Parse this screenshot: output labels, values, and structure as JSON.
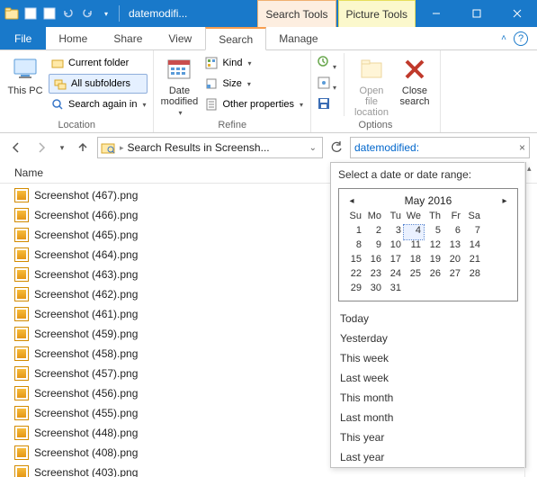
{
  "titlebar": {
    "app_title": "datemodifi...",
    "search_tools_label": "Search Tools",
    "picture_tools_label": "Picture Tools"
  },
  "tabs": {
    "file": "File",
    "home": "Home",
    "share": "Share",
    "view": "View",
    "search": "Search",
    "manage": "Manage"
  },
  "ribbon": {
    "location": {
      "this_pc": "This\nPC",
      "current_folder": "Current folder",
      "all_subfolders": "All subfolders",
      "search_again_in": "Search again in",
      "group_label": "Location"
    },
    "refine": {
      "date_modified": "Date\nmodified",
      "kind": "Kind",
      "size": "Size",
      "other_properties": "Other properties",
      "group_label": "Refine"
    },
    "options": {
      "open_file_location": "Open file\nlocation",
      "close_search": "Close\nsearch",
      "group_label": "Options"
    }
  },
  "address": {
    "path_text": "Search Results in Screensh..."
  },
  "search": {
    "query": "datemodified:"
  },
  "column_header": "Name",
  "files": [
    "Screenshot (467).png",
    "Screenshot (466).png",
    "Screenshot (465).png",
    "Screenshot (464).png",
    "Screenshot (463).png",
    "Screenshot (462).png",
    "Screenshot (461).png",
    "Screenshot (459).png",
    "Screenshot (458).png",
    "Screenshot (457).png",
    "Screenshot (456).png",
    "Screenshot (455).png",
    "Screenshot (448).png",
    "Screenshot (408).png",
    "Screenshot (403).png"
  ],
  "date_popup": {
    "title": "Select a date or date range:",
    "month_label": "May 2016",
    "day_headers": [
      "Su",
      "Mo",
      "Tu",
      "We",
      "Th",
      "Fr",
      "Sa"
    ],
    "weeks": [
      [
        1,
        2,
        3,
        4,
        5,
        6,
        7
      ],
      [
        8,
        9,
        10,
        11,
        12,
        13,
        14
      ],
      [
        15,
        16,
        17,
        18,
        19,
        20,
        21
      ],
      [
        22,
        23,
        24,
        25,
        26,
        27,
        28
      ],
      [
        29,
        30,
        31,
        null,
        null,
        null,
        null
      ]
    ],
    "today_day": 4,
    "ranges": [
      "Today",
      "Yesterday",
      "This week",
      "Last week",
      "This month",
      "Last month",
      "This year",
      "Last year"
    ]
  }
}
